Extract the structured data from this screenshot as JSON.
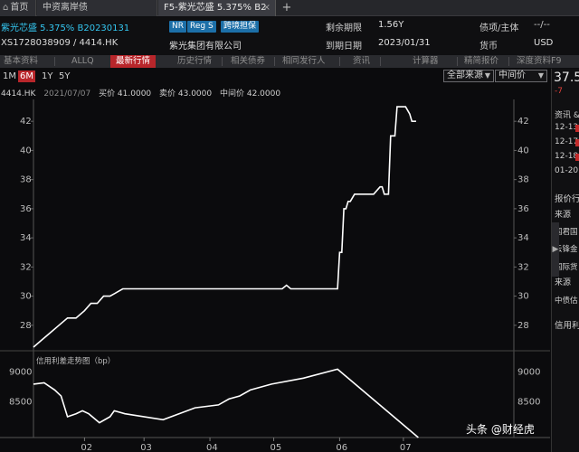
{
  "tabs": {
    "home": "首页",
    "bonds": "中资离岸债",
    "active": "F5-紫光芯盛 5.375% B2",
    "close": "×",
    "add": "+"
  },
  "bond": {
    "title": "紫光芯盛 5.375% B20230131",
    "codes": "XS1728038909 / 4414.HK",
    "badges": [
      "NR",
      "Reg S",
      "跨境担保"
    ],
    "issuer": "紫光集团有限公司",
    "remaining_label": "剩余期限",
    "remaining_value": "1.56Y",
    "maturity_label": "到期日期",
    "maturity_value": "2023/01/31",
    "rating_label": "债项/主体",
    "rating_value": "--/--",
    "currency_label": "货币",
    "currency_value": "USD"
  },
  "menu": {
    "items": [
      "基本资料",
      "ALLQ",
      "最新行情",
      "历史行情",
      "相关债券",
      "相同发行人",
      "资讯",
      "计算器",
      "精简报价",
      "深度资料F9"
    ],
    "active": "最新行情"
  },
  "chart_controls": {
    "ranges": [
      "1M",
      "6M",
      "1Y",
      "5Y"
    ],
    "active_range": "6M",
    "source_select": "全部来源",
    "price_select": "中间价",
    "dropdown_arrow": "▼"
  },
  "quote": {
    "code": "4414.HK",
    "date": "2021/07/07",
    "bid": "买价 41.0000",
    "ask": "卖价 43.0000",
    "mid": "中间价 42.0000"
  },
  "right_panel": {
    "price": "37.5",
    "change": "-7",
    "hdr1": "资讯 &",
    "dates": [
      "12-13",
      "12-17",
      "12-18",
      "01-20"
    ],
    "hdr2": "报价行",
    "source1": "来源",
    "sources": [
      "国君国",
      "云锋金",
      "国际货"
    ],
    "source2": "来源",
    "source_last": "中债估",
    "hdr3": "信用利",
    "collapse": "▶"
  },
  "watermark": "头条 @财经虎",
  "colors": {
    "accent_red": "#b8262b",
    "title_blue": "#34c6f0",
    "badge_blue": "#1c6fa8",
    "line_white": "#ffffff",
    "background": "#0b0b0d"
  },
  "chart_data": [
    {
      "type": "line",
      "title": "",
      "series": [
        {
          "x": [
            "2021-01-08",
            "2021-01-12",
            "2021-01-16",
            "2021-01-20",
            "2021-01-24",
            "2021-01-28",
            "2021-02-01",
            "2021-02-04",
            "2021-02-07",
            "2021-02-10",
            "2021-02-13",
            "2021-02-16",
            "2021-02-19",
            "2021-02-22",
            "2021-02-25",
            "2021-03-01",
            "2021-03-10",
            "2021-03-20",
            "2021-04-01",
            "2021-04-15",
            "2021-05-01",
            "2021-05-05",
            "2021-05-07",
            "2021-05-09",
            "2021-05-12",
            "2021-05-20",
            "2021-05-31",
            "2021-06-01",
            "2021-06-02",
            "2021-06-03",
            "2021-06-04",
            "2021-06-05",
            "2021-06-06",
            "2021-06-08",
            "2021-06-11",
            "2021-06-14",
            "2021-06-17",
            "2021-06-20",
            "2021-06-21",
            "2021-06-22",
            "2021-06-24",
            "2021-06-25",
            "2021-06-27",
            "2021-06-28",
            "2021-06-30",
            "2021-07-01",
            "2021-07-02",
            "2021-07-04",
            "2021-07-05",
            "2021-07-07"
          ],
          "values": [
            26.5,
            27.0,
            27.5,
            28.0,
            28.5,
            28.5,
            29.0,
            29.5,
            29.5,
            30.0,
            30.0,
            30.25,
            30.5,
            30.5,
            30.5,
            30.5,
            30.5,
            30.5,
            30.5,
            30.5,
            30.5,
            30.5,
            30.75,
            30.5,
            30.5,
            30.5,
            30.5,
            33.0,
            33.0,
            36.0,
            36.0,
            36.5,
            36.5,
            37.0,
            37.0,
            37.0,
            37.0,
            37.5,
            37.5,
            37.0,
            37.0,
            41.0,
            41.0,
            43.0,
            43.0,
            43.0,
            43.0,
            42.5,
            42.0,
            42.0
          ]
        }
      ],
      "x_ticks": [
        "02",
        "03",
        "04",
        "05",
        "06",
        "07"
      ],
      "y_ticks": [
        28,
        30,
        32,
        34,
        36,
        38,
        40,
        42
      ],
      "ylim": [
        26.5,
        43.5
      ],
      "grid": false
    },
    {
      "type": "line",
      "title": "信用利差走势图（bp）",
      "series": [
        {
          "x": [
            "2021-01-08",
            "2021-01-13",
            "2021-01-18",
            "2021-01-21",
            "2021-01-24",
            "2021-01-28",
            "2021-01-31",
            "2021-02-03",
            "2021-02-08",
            "2021-02-13",
            "2021-02-15",
            "2021-02-20",
            "2021-03-10",
            "2021-03-25",
            "2021-04-05",
            "2021-04-10",
            "2021-04-15",
            "2021-04-20",
            "2021-04-30",
            "2021-05-15",
            "2021-05-31",
            "2021-07-08"
          ],
          "values": [
            8800,
            8820,
            8700,
            8600,
            8250,
            8300,
            8350,
            8300,
            8150,
            8250,
            8350,
            8300,
            8200,
            8400,
            8450,
            8550,
            8600,
            8700,
            8800,
            8900,
            9050,
            7900
          ]
        }
      ],
      "y_ticks": [
        8500,
        9000
      ],
      "ylim": [
        7900,
        9300
      ],
      "grid": false
    }
  ]
}
